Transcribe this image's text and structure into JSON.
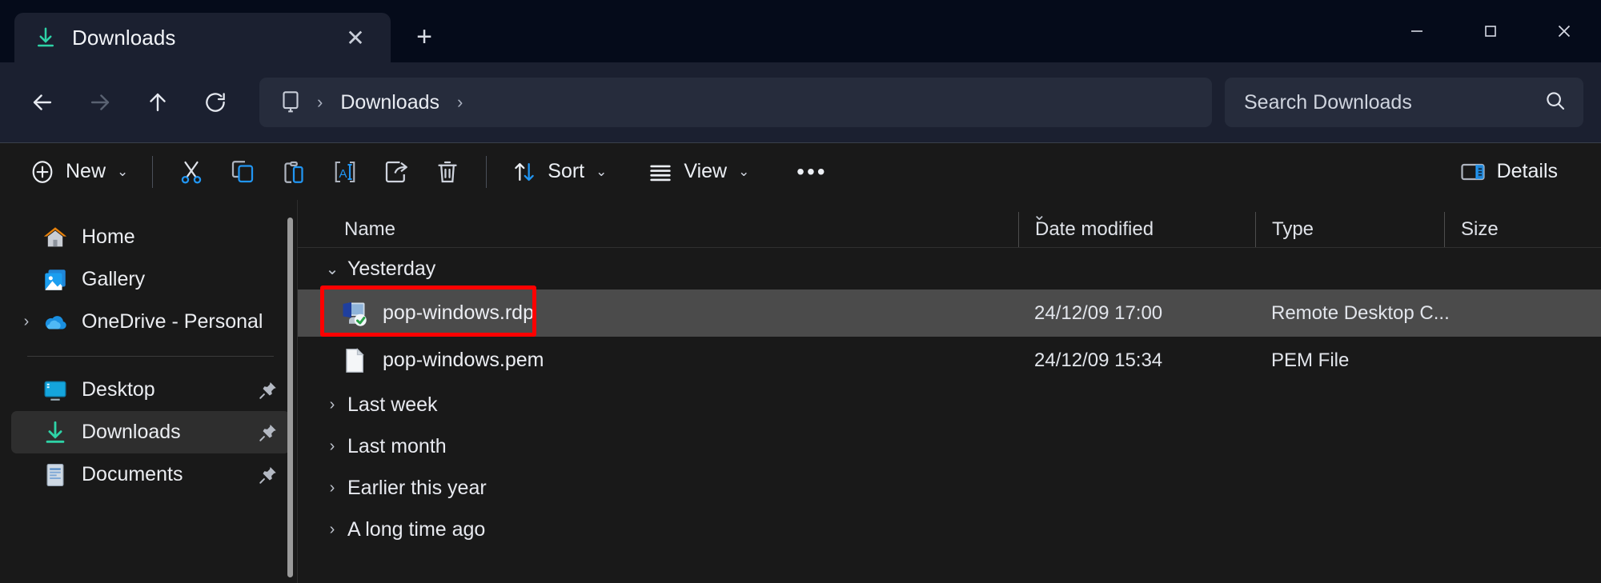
{
  "window": {
    "controls": [
      {
        "name": "minimize",
        "glyph": "─"
      },
      {
        "name": "maximize",
        "glyph": "□"
      },
      {
        "name": "close",
        "glyph": "✕"
      }
    ]
  },
  "tab": {
    "title": "Downloads",
    "icon": "download-icon",
    "icon_color": "#2ED3A7",
    "close_glyph": "✕",
    "newtab_glyph": "+"
  },
  "nav": {
    "back_glyph": "←",
    "forward_glyph": "→",
    "up_glyph": "↑",
    "refresh_glyph": "↻",
    "breadcrumb_icon": "this-pc-icon",
    "breadcrumbs": [
      "Downloads"
    ],
    "separator": "›"
  },
  "search": {
    "placeholder": "Search Downloads",
    "value": "",
    "icon": "search-icon"
  },
  "toolbar": {
    "new_label": "New",
    "new_chevron": "⌄",
    "cut_label": "Cut",
    "copy_label": "Copy",
    "paste_label": "Paste",
    "rename_label": "Rename",
    "share_label": "Share",
    "delete_label": "Delete",
    "sort_label": "Sort",
    "sort_chevron": "⌄",
    "view_label": "View",
    "view_chevron": "⌄",
    "more_label": "See more",
    "more_glyph": "•••",
    "details_label": "Details",
    "accent": "#2196F3"
  },
  "sidebar": {
    "items": [
      {
        "label": "Home",
        "icon": "home-icon",
        "expander": "",
        "pinned": false,
        "selected": false
      },
      {
        "label": "Gallery",
        "icon": "gallery-icon",
        "expander": "",
        "pinned": false,
        "selected": false
      },
      {
        "label": "OneDrive - Personal",
        "icon": "onedrive-icon",
        "expander": "›",
        "pinned": false,
        "selected": false
      },
      {
        "label": "Desktop",
        "icon": "desktop-icon",
        "expander": "",
        "pinned": true,
        "selected": false
      },
      {
        "label": "Downloads",
        "icon": "downloads-icon",
        "expander": "",
        "pinned": true,
        "selected": true
      },
      {
        "label": "Documents",
        "icon": "documents-icon",
        "expander": "",
        "pinned": true,
        "selected": false
      }
    ]
  },
  "filelist": {
    "columns": [
      {
        "key": "name",
        "label": "Name",
        "sorted": true,
        "sort_caret": "⌄"
      },
      {
        "key": "date",
        "label": "Date modified",
        "sorted": false,
        "sort_caret": ""
      },
      {
        "key": "type",
        "label": "Type",
        "sorted": false,
        "sort_caret": ""
      },
      {
        "key": "size",
        "label": "Size",
        "sorted": false,
        "sort_caret": ""
      }
    ],
    "groups": [
      {
        "label": "Yesterday",
        "expanded": true,
        "chevron": "⌄",
        "files": [
          {
            "name": "pop-windows.rdp",
            "date": "24/12/09 17:00",
            "type": "Remote Desktop C...",
            "size": "",
            "icon": "rdp-file-icon",
            "selected": true,
            "highlighted": true
          },
          {
            "name": "pop-windows.pem",
            "date": "24/12/09 15:34",
            "type": "PEM File",
            "size": "",
            "icon": "generic-file-icon",
            "selected": false,
            "highlighted": false
          }
        ]
      },
      {
        "label": "Last week",
        "expanded": false,
        "chevron": "›",
        "files": []
      },
      {
        "label": "Last month",
        "expanded": false,
        "chevron": "›",
        "files": []
      },
      {
        "label": "Earlier this year",
        "expanded": false,
        "chevron": "›",
        "files": []
      },
      {
        "label": "A long time ago",
        "expanded": false,
        "chevron": "›",
        "files": []
      }
    ]
  },
  "annotation": {
    "color": "#FE0000",
    "target": "pop-windows.rdp"
  }
}
